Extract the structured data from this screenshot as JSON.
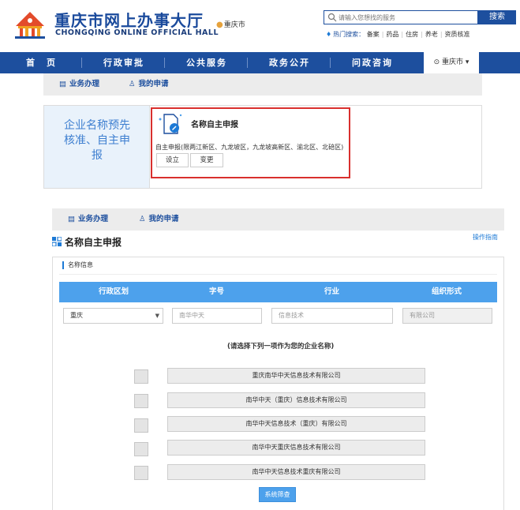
{
  "brand": {
    "title_cn": "重庆市网上办事大厅",
    "title_en": "CHONGQING ONLINE OFFICIAL HALL",
    "logo_icon": "government-building-logo",
    "accent_color": "#1d4f9e"
  },
  "header": {
    "location": "重庆市",
    "search_placeholder": "请输入您想找的服务",
    "search_button": "搜索",
    "hot_label": "热门搜索：",
    "hot_items": [
      "备案",
      "药品",
      "住房",
      "养老",
      "资质核准"
    ]
  },
  "nav": {
    "items": [
      "首　页",
      "行政审批",
      "公共服务",
      "政务公开",
      "问政咨询"
    ],
    "city": "重庆市"
  },
  "tabs_top": {
    "business": "业务办理",
    "my_apply": "我的申请"
  },
  "card": {
    "category": "企业名称预先核准、自主申报",
    "title": "名称自主申报",
    "desc": "自主申报(限两江新区、九龙坡区，九龙坡高新区、渝北区、北碚区)",
    "btn_setup": "设立",
    "btn_change": "变更"
  },
  "tabs_bottom": {
    "business": "业务办理",
    "my_apply": "我的申请"
  },
  "form": {
    "page_title": "名称自主申报",
    "guide_link": "操作指南",
    "section_label": "名称信息",
    "headers": [
      "行政区划",
      "字号",
      "行业",
      "组织形式"
    ],
    "region_value": "重庆",
    "name_placeholder": "南华中天",
    "industry_placeholder": "信息技术",
    "org_value": "有限公司",
    "prompt": "(请选择下列一项作为您的企业名称)",
    "options": [
      "重庆南华中天信息技术有限公司",
      "南华中天（重庆）信息技术有限公司",
      "南华中天信息技术（重庆）有限公司",
      "南华中天重庆信息技术有限公司",
      "南华中天信息技术重庆有限公司"
    ],
    "filter_button": "系统筛查"
  }
}
